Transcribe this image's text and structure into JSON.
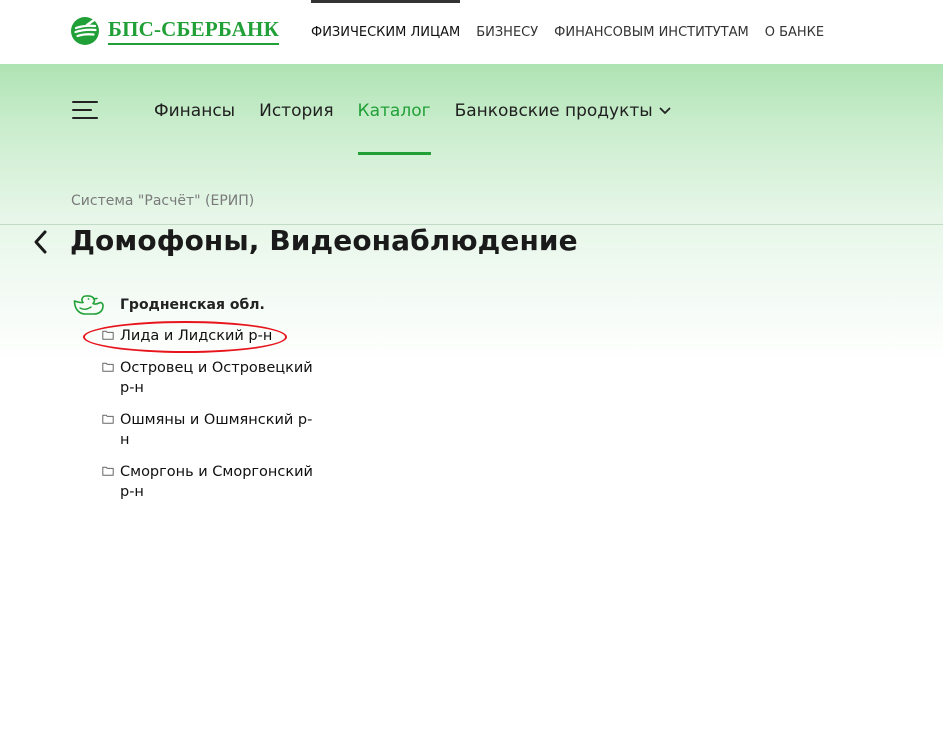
{
  "logo": {
    "name": "БПС-СБЕРБАНК",
    "icon": "sberbank-logo-icon",
    "color": "#21a038"
  },
  "top_nav": [
    {
      "label": "ФИЗИЧЕСКИМ ЛИЦАМ",
      "active": true
    },
    {
      "label": "БИЗНЕСУ",
      "active": false
    },
    {
      "label": "ФИНАНСОВЫМ ИНСТИТУТАМ",
      "active": false
    },
    {
      "label": "О БАНКЕ",
      "active": false
    }
  ],
  "main_nav": {
    "menu_icon": "hamburger-menu-icon",
    "items": [
      {
        "label": "Финансы",
        "active": false
      },
      {
        "label": "История",
        "active": false
      },
      {
        "label": "Каталог",
        "active": true
      },
      {
        "label": "Банковские продукты",
        "active": false,
        "has_dropdown": true
      }
    ]
  },
  "breadcrumb": "Система \"Расчёт\" (ЕРИП)",
  "back_icon": "chevron-left-icon",
  "page_title": "Домофоны, Видеонаблюдение",
  "tree": {
    "region": {
      "label": "Гродненская обл.",
      "icon": "duck-icon"
    },
    "items": [
      {
        "label": "Лида и Лидский р-н",
        "icon": "folder-icon",
        "highlighted": true
      },
      {
        "label": "Островец и Островецкий р-н",
        "icon": "folder-icon",
        "highlighted": false
      },
      {
        "label": "Ошмяны и Ошмянский р-н",
        "icon": "folder-icon",
        "highlighted": false
      },
      {
        "label": "Сморгонь и Сморгонский р-н",
        "icon": "folder-icon",
        "highlighted": false
      }
    ]
  },
  "colors": {
    "accent": "#21a038",
    "highlight_ring": "#e8141c",
    "band_top": "#aee3b3"
  }
}
